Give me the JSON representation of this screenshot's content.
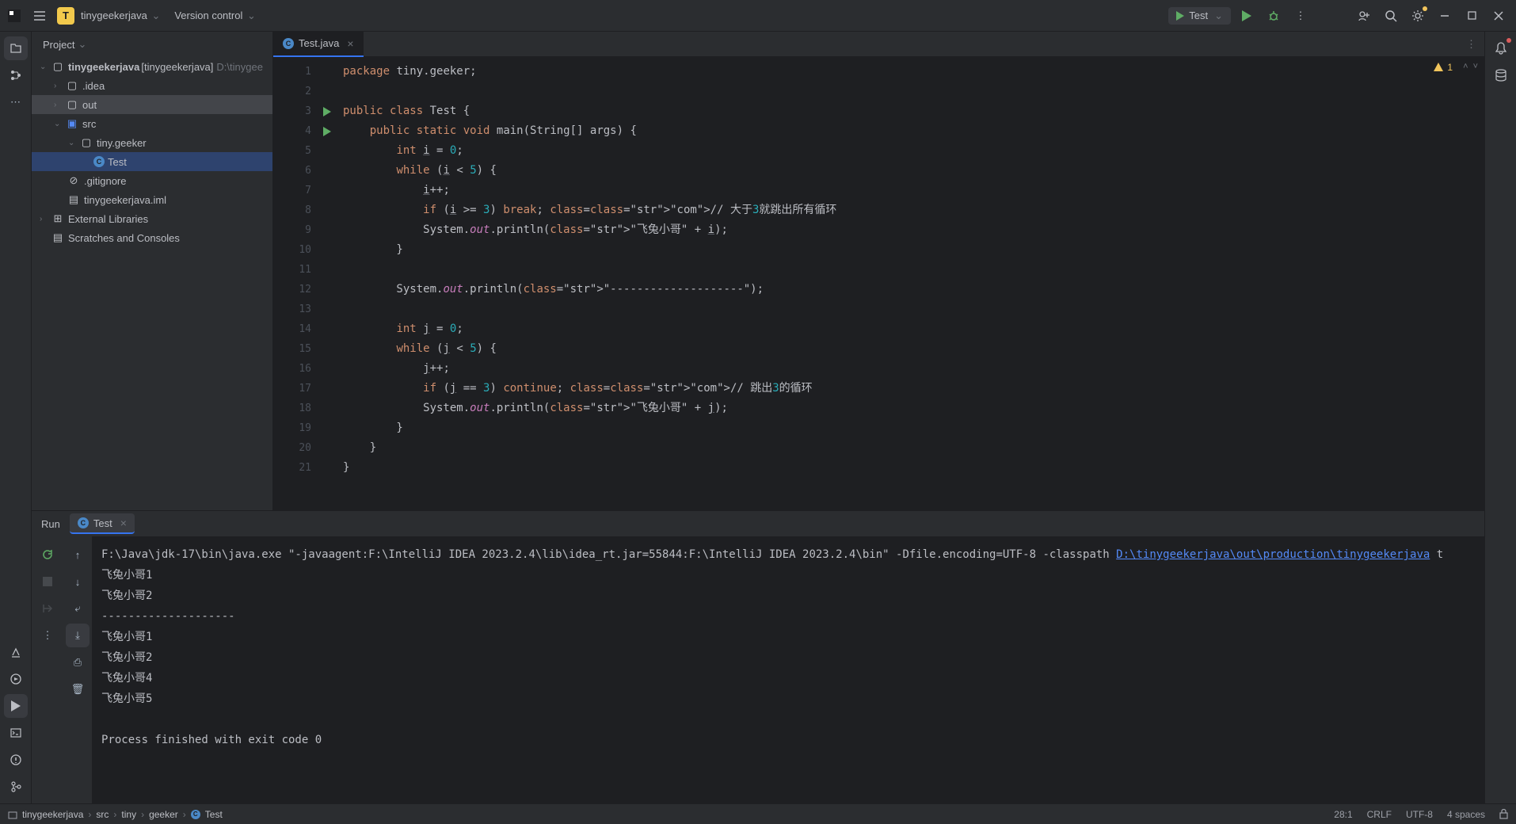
{
  "titlebar": {
    "project_initial": "T",
    "project_name": "tinygeekerjava",
    "vcs_label": "Version control"
  },
  "run_config": {
    "name": "Test"
  },
  "project_panel": {
    "header": "Project",
    "tree": {
      "root_name": "tinygeekerjava",
      "root_bracket": "[tinygeekerjava]",
      "root_path": "D:\\tinygee",
      "idea": ".idea",
      "out": "out",
      "src": "src",
      "pkg": "tiny.geeker",
      "cls": "Test",
      "gitignore": ".gitignore",
      "iml": "tinygeekerjava.iml",
      "ext": "External Libraries",
      "scratch": "Scratches and Consoles"
    }
  },
  "editor": {
    "tab_name": "Test.java",
    "warning_count": "1",
    "lines": [
      "package tiny.geeker;",
      "",
      "public class Test {",
      "    public static void main(String[] args) {",
      "        int i = 0;",
      "        while (i < 5) {",
      "            i++;",
      "            if (i >= 3) break; // 大于3就跳出所有循环",
      "            System.out.println(\"飞兔小哥\" + i);",
      "        }",
      "",
      "        System.out.println(\"--------------------\");",
      "",
      "        int j = 0;",
      "        while (j < 5) {",
      "            j++;",
      "            if (j == 3) continue; // 跳出3的循环",
      "            System.out.println(\"飞兔小哥\" + j);",
      "        }",
      "    }",
      "}"
    ]
  },
  "run_panel": {
    "title": "Run",
    "tab": "Test"
  },
  "console": {
    "cmd_prefix": "F:\\Java\\jdk-17\\bin\\java.exe \"-javaagent:F:\\IntelliJ IDEA 2023.2.4\\lib\\idea_rt.jar=55844:F:\\IntelliJ IDEA 2023.2.4\\bin\" -Dfile.encoding=UTF-8 -classpath ",
    "cmd_link": "D:\\tinygeekerjava\\out\\production\\tinygeekerjava",
    "cmd_suffix": " t",
    "l1": "飞兔小哥1",
    "l2": "飞兔小哥2",
    "sep": "--------------------",
    "l4": "飞兔小哥1",
    "l5": "飞兔小哥2",
    "l6": "飞兔小哥4",
    "l7": "飞兔小哥5",
    "exit": "Process finished with exit code 0"
  },
  "statusbar": {
    "crumbs": [
      "tinygeekerjava",
      "src",
      "tiny",
      "geeker",
      "Test"
    ],
    "position": "28:1",
    "line_sep": "CRLF",
    "encoding": "UTF-8",
    "indent": "4 spaces"
  }
}
